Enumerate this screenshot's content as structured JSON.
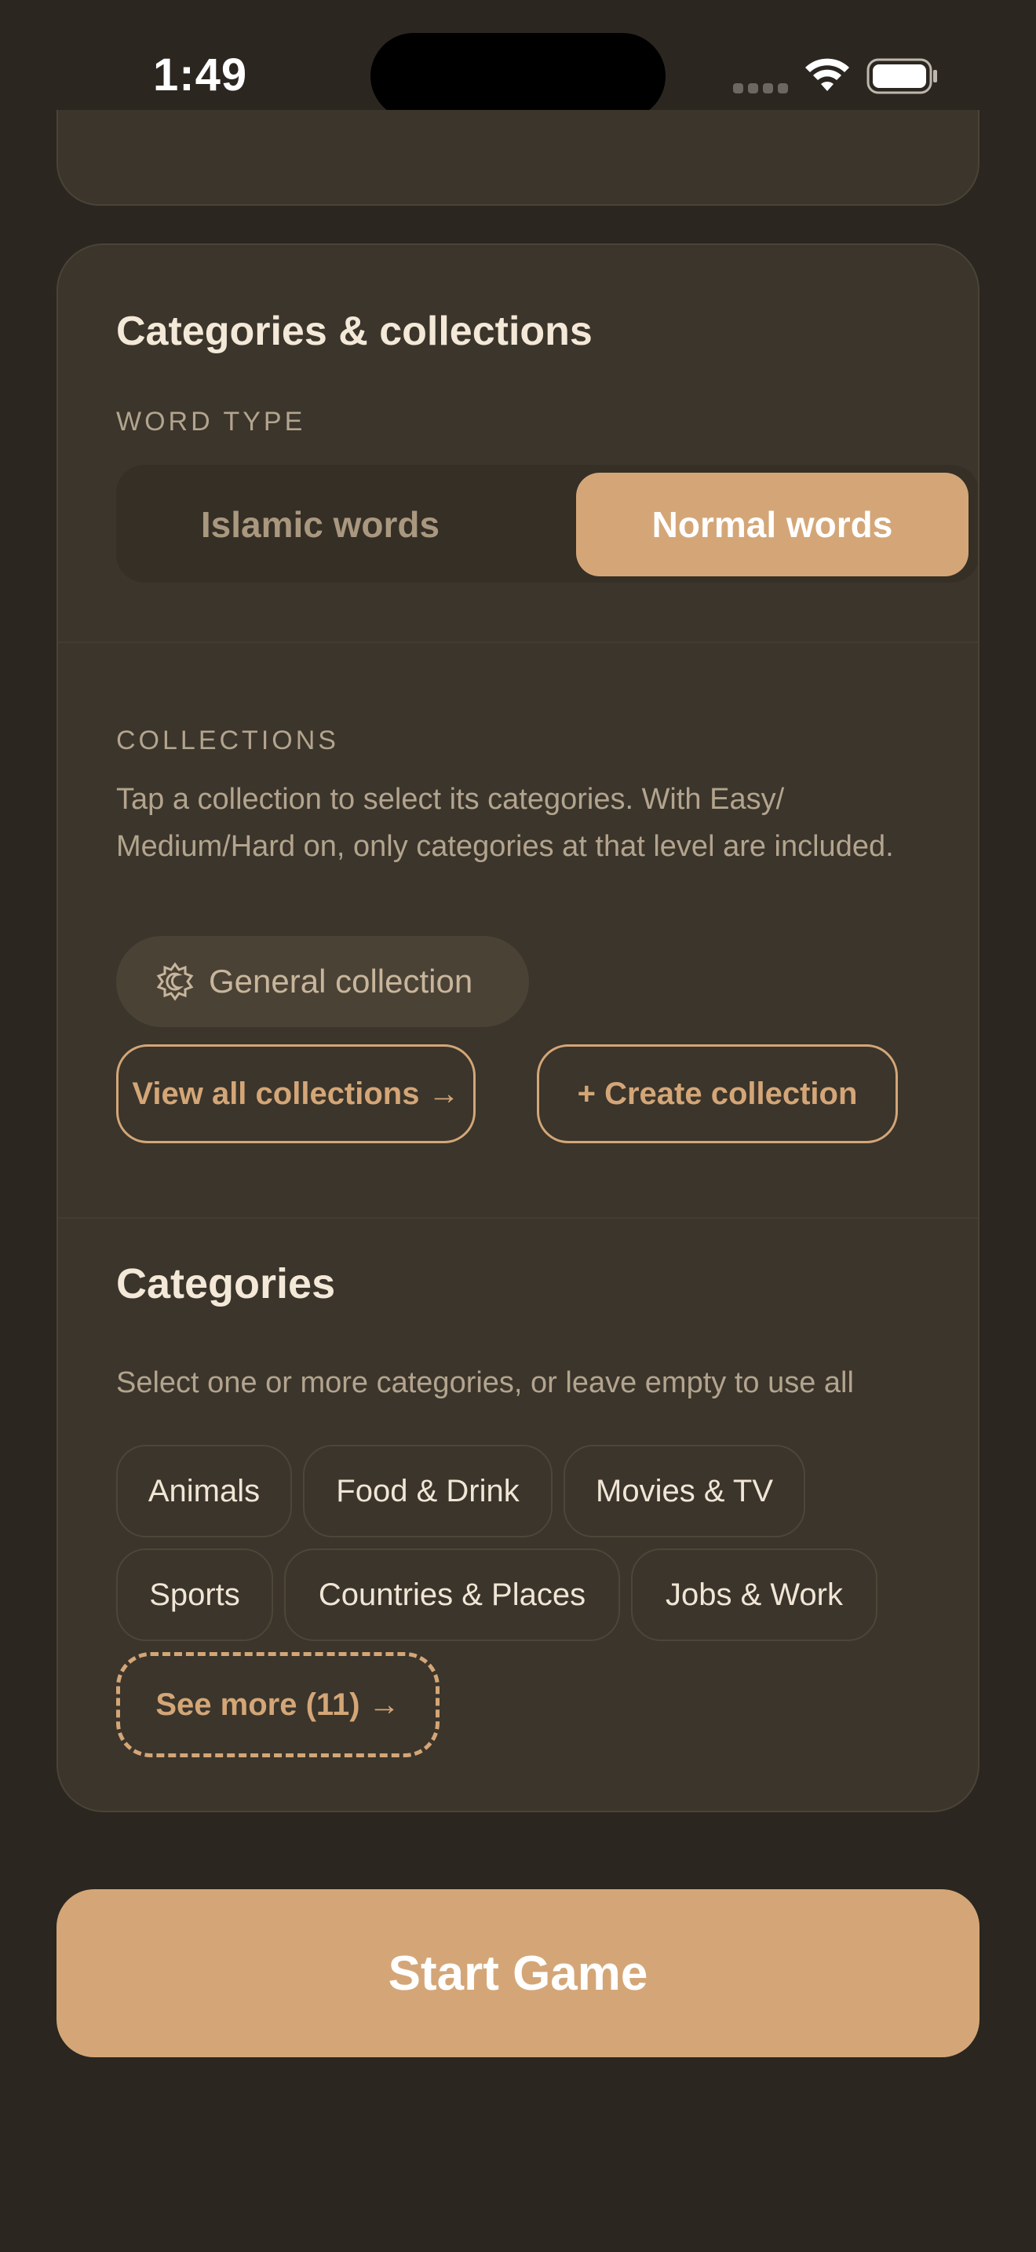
{
  "status_bar": {
    "time": "1:49"
  },
  "card": {
    "title": "Categories & collections",
    "word_type": {
      "label": "WORD TYPE",
      "options": [
        "Islamic words",
        "Normal words"
      ],
      "selected": "Normal words"
    },
    "collections": {
      "label": "COLLECTIONS",
      "description": "Tap a collection to select its categories. With Easy/ Medium/Hard on, only categories at that level are included.",
      "chip_label": "General collection",
      "chip_icon": "sun-moon-icon",
      "view_all_label": "View all collections →",
      "create_label": "+ Create collection"
    },
    "categories": {
      "title": "Categories",
      "description": "Select one or more categories, or leave empty to use all",
      "items": [
        "Animals",
        "Food & Drink",
        "Movies & TV",
        "Sports",
        "Countries & Places",
        "Jobs & Work"
      ],
      "see_more_label": "See more (11) →"
    }
  },
  "start_button_label": "Start Game",
  "colors": {
    "background": "#2b2620",
    "card": "#3b352b",
    "accent": "#d4a677",
    "text_primary": "#f4e9d8",
    "text_secondary": "#b3a48e"
  }
}
